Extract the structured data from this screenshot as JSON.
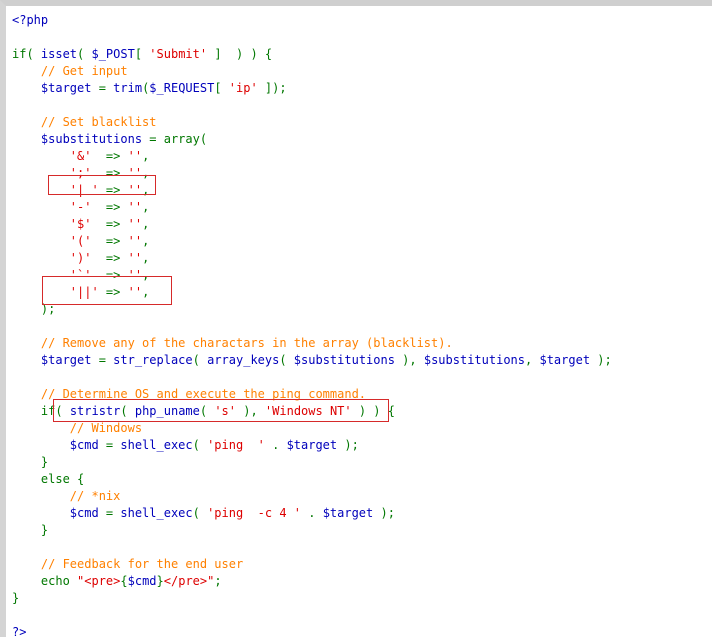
{
  "colors": {
    "keyword": "#007700",
    "identifier": "#0000BB",
    "comment": "#FF8000",
    "string": "#DD0000",
    "highlight_border": "#d62a2a"
  },
  "code": {
    "lines": [
      [
        {
          "t": "<?php",
          "k": "b"
        }
      ],
      [],
      [
        {
          "t": "if( ",
          "k": "k"
        },
        {
          "t": "isset",
          "k": "b"
        },
        {
          "t": "( ",
          "k": "k"
        },
        {
          "t": "$_POST",
          "k": "b"
        },
        {
          "t": "[ ",
          "k": "k"
        },
        {
          "t": "'Submit'",
          "k": "s"
        },
        {
          "t": " ]  ) ) {",
          "k": "k"
        }
      ],
      [
        {
          "t": "    ",
          "k": "p"
        },
        {
          "t": "// Get input",
          "k": "c"
        }
      ],
      [
        {
          "t": "    ",
          "k": "p"
        },
        {
          "t": "$target ",
          "k": "b"
        },
        {
          "t": "= ",
          "k": "k"
        },
        {
          "t": "trim",
          "k": "b"
        },
        {
          "t": "(",
          "k": "k"
        },
        {
          "t": "$_REQUEST",
          "k": "b"
        },
        {
          "t": "[ ",
          "k": "k"
        },
        {
          "t": "'ip'",
          "k": "s"
        },
        {
          "t": " ]);",
          "k": "k"
        }
      ],
      [],
      [
        {
          "t": "    ",
          "k": "p"
        },
        {
          "t": "// Set blacklist",
          "k": "c"
        }
      ],
      [
        {
          "t": "    ",
          "k": "p"
        },
        {
          "t": "$substitutions ",
          "k": "b"
        },
        {
          "t": "= array(",
          "k": "k"
        }
      ],
      [
        {
          "t": "        ",
          "k": "p"
        },
        {
          "t": "'&'",
          "k": "s"
        },
        {
          "t": "  => ",
          "k": "k"
        },
        {
          "t": "''",
          "k": "s"
        },
        {
          "t": ",",
          "k": "k"
        }
      ],
      [
        {
          "t": "        ",
          "k": "p"
        },
        {
          "t": "';'",
          "k": "s"
        },
        {
          "t": "  => ",
          "k": "k"
        },
        {
          "t": "''",
          "k": "s"
        },
        {
          "t": ",",
          "k": "k"
        }
      ],
      [
        {
          "t": "        ",
          "k": "p"
        },
        {
          "t": "'| '",
          "k": "s"
        },
        {
          "t": " => ",
          "k": "k"
        },
        {
          "t": "''",
          "k": "s"
        },
        {
          "t": ",",
          "k": "k"
        }
      ],
      [
        {
          "t": "        ",
          "k": "p"
        },
        {
          "t": "'-'",
          "k": "s"
        },
        {
          "t": "  => ",
          "k": "k"
        },
        {
          "t": "''",
          "k": "s"
        },
        {
          "t": ",",
          "k": "k"
        }
      ],
      [
        {
          "t": "        ",
          "k": "p"
        },
        {
          "t": "'$'",
          "k": "s"
        },
        {
          "t": "  => ",
          "k": "k"
        },
        {
          "t": "''",
          "k": "s"
        },
        {
          "t": ",",
          "k": "k"
        }
      ],
      [
        {
          "t": "        ",
          "k": "p"
        },
        {
          "t": "'('",
          "k": "s"
        },
        {
          "t": "  => ",
          "k": "k"
        },
        {
          "t": "''",
          "k": "s"
        },
        {
          "t": ",",
          "k": "k"
        }
      ],
      [
        {
          "t": "        ",
          "k": "p"
        },
        {
          "t": "')'",
          "k": "s"
        },
        {
          "t": "  => ",
          "k": "k"
        },
        {
          "t": "''",
          "k": "s"
        },
        {
          "t": ",",
          "k": "k"
        }
      ],
      [
        {
          "t": "        ",
          "k": "p"
        },
        {
          "t": "'`'",
          "k": "s"
        },
        {
          "t": "  => ",
          "k": "k"
        },
        {
          "t": "''",
          "k": "s"
        },
        {
          "t": ",",
          "k": "k"
        }
      ],
      [
        {
          "t": "        ",
          "k": "p"
        },
        {
          "t": "'||'",
          "k": "s"
        },
        {
          "t": " => ",
          "k": "k"
        },
        {
          "t": "''",
          "k": "s"
        },
        {
          "t": ",",
          "k": "k"
        }
      ],
      [
        {
          "t": "    );",
          "k": "k"
        }
      ],
      [],
      [
        {
          "t": "    ",
          "k": "p"
        },
        {
          "t": "// Remove any of the charactars in the array (blacklist).",
          "k": "c"
        }
      ],
      [
        {
          "t": "    ",
          "k": "p"
        },
        {
          "t": "$target ",
          "k": "b"
        },
        {
          "t": "= ",
          "k": "k"
        },
        {
          "t": "str_replace",
          "k": "b"
        },
        {
          "t": "( ",
          "k": "k"
        },
        {
          "t": "array_keys",
          "k": "b"
        },
        {
          "t": "( ",
          "k": "k"
        },
        {
          "t": "$substitutions ",
          "k": "b"
        },
        {
          "t": "), ",
          "k": "k"
        },
        {
          "t": "$substitutions",
          "k": "b"
        },
        {
          "t": ", ",
          "k": "k"
        },
        {
          "t": "$target ",
          "k": "b"
        },
        {
          "t": ");",
          "k": "k"
        }
      ],
      [],
      [
        {
          "t": "    ",
          "k": "p"
        },
        {
          "t": "// Determine OS and execute the ping command.",
          "k": "c"
        }
      ],
      [
        {
          "t": "    ",
          "k": "p"
        },
        {
          "t": "if( ",
          "k": "k"
        },
        {
          "t": "stristr",
          "k": "b"
        },
        {
          "t": "( ",
          "k": "k"
        },
        {
          "t": "php_uname",
          "k": "b"
        },
        {
          "t": "( ",
          "k": "k"
        },
        {
          "t": "'s'",
          "k": "s"
        },
        {
          "t": " ), ",
          "k": "k"
        },
        {
          "t": "'Windows NT'",
          "k": "s"
        },
        {
          "t": " ) ) {",
          "k": "k"
        }
      ],
      [
        {
          "t": "        ",
          "k": "p"
        },
        {
          "t": "// Windows",
          "k": "c"
        }
      ],
      [
        {
          "t": "        ",
          "k": "p"
        },
        {
          "t": "$cmd ",
          "k": "b"
        },
        {
          "t": "= ",
          "k": "k"
        },
        {
          "t": "shell_exec",
          "k": "b"
        },
        {
          "t": "( ",
          "k": "k"
        },
        {
          "t": "'ping  '",
          "k": "s"
        },
        {
          "t": " . ",
          "k": "k"
        },
        {
          "t": "$target ",
          "k": "b"
        },
        {
          "t": ");",
          "k": "k"
        }
      ],
      [
        {
          "t": "    }",
          "k": "k"
        }
      ],
      [
        {
          "t": "    else {",
          "k": "k"
        }
      ],
      [
        {
          "t": "        ",
          "k": "p"
        },
        {
          "t": "// *nix",
          "k": "c"
        }
      ],
      [
        {
          "t": "        ",
          "k": "p"
        },
        {
          "t": "$cmd ",
          "k": "b"
        },
        {
          "t": "= ",
          "k": "k"
        },
        {
          "t": "shell_exec",
          "k": "b"
        },
        {
          "t": "( ",
          "k": "k"
        },
        {
          "t": "'ping  -c 4 '",
          "k": "s"
        },
        {
          "t": " . ",
          "k": "k"
        },
        {
          "t": "$target ",
          "k": "b"
        },
        {
          "t": ");",
          "k": "k"
        }
      ],
      [
        {
          "t": "    }",
          "k": "k"
        }
      ],
      [],
      [
        {
          "t": "    ",
          "k": "p"
        },
        {
          "t": "// Feedback for the end user",
          "k": "c"
        }
      ],
      [
        {
          "t": "    ",
          "k": "p"
        },
        {
          "t": "echo ",
          "k": "k"
        },
        {
          "t": "\"<pre>",
          "k": "s"
        },
        {
          "t": "{",
          "k": "k"
        },
        {
          "t": "$cmd",
          "k": "b"
        },
        {
          "t": "}",
          "k": "k"
        },
        {
          "t": "</pre>\"",
          "k": "s"
        },
        {
          "t": ";",
          "k": "k"
        }
      ],
      [
        {
          "t": "}",
          "k": "k"
        }
      ],
      [],
      [
        {
          "t": "?>",
          "k": "b"
        }
      ]
    ]
  }
}
